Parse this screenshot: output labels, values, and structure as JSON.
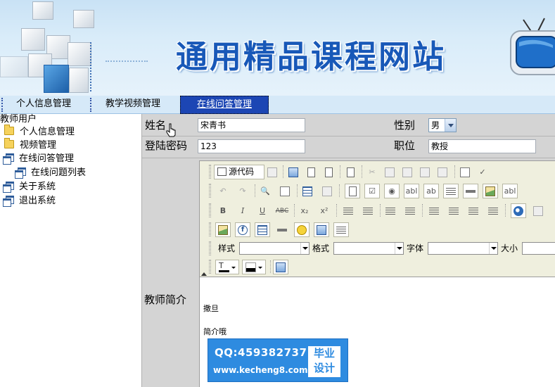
{
  "banner": {
    "title": "通用精品课程网站"
  },
  "nav": {
    "tabs": [
      {
        "label": "个人信息管理"
      },
      {
        "label": "教学视频管理"
      },
      {
        "label": "在线问答管理"
      }
    ]
  },
  "sidebar": {
    "root": "教师用户",
    "items": [
      {
        "label": "个人信息管理",
        "icon": "folder-icon"
      },
      {
        "label": "视频管理",
        "icon": "folder-icon"
      },
      {
        "label": "在线问答管理",
        "icon": "window-icon"
      },
      {
        "label": "在线问题列表",
        "icon": "window-icon"
      },
      {
        "label": "关于系统",
        "icon": "window-icon"
      },
      {
        "label": "退出系统",
        "icon": "window-icon"
      }
    ]
  },
  "form": {
    "name_label": "姓名",
    "name_value": "宋青书",
    "gender_label": "性别",
    "gender_value": "男",
    "password_label": "登陆密码",
    "password_value": "123",
    "position_label": "职位",
    "position_value": "教授",
    "intro_label": "教师简介"
  },
  "editor": {
    "source_button": "源代码",
    "style_label": "样式",
    "format_label": "格式",
    "font_label": "字体",
    "size_label": "大小",
    "body_lines": [
      "撒旦",
      "简介哦"
    ]
  },
  "watermark": {
    "qq": "QQ:459382737",
    "site": "www.kecheng8.com",
    "badge_line1": "毕业",
    "badge_line2": "设计"
  },
  "colors": {
    "nav_active": "#1c46b4",
    "title_blue": "#1858b8",
    "editor_toolbar": "#efefde",
    "form_bg": "#d4d4d4"
  }
}
